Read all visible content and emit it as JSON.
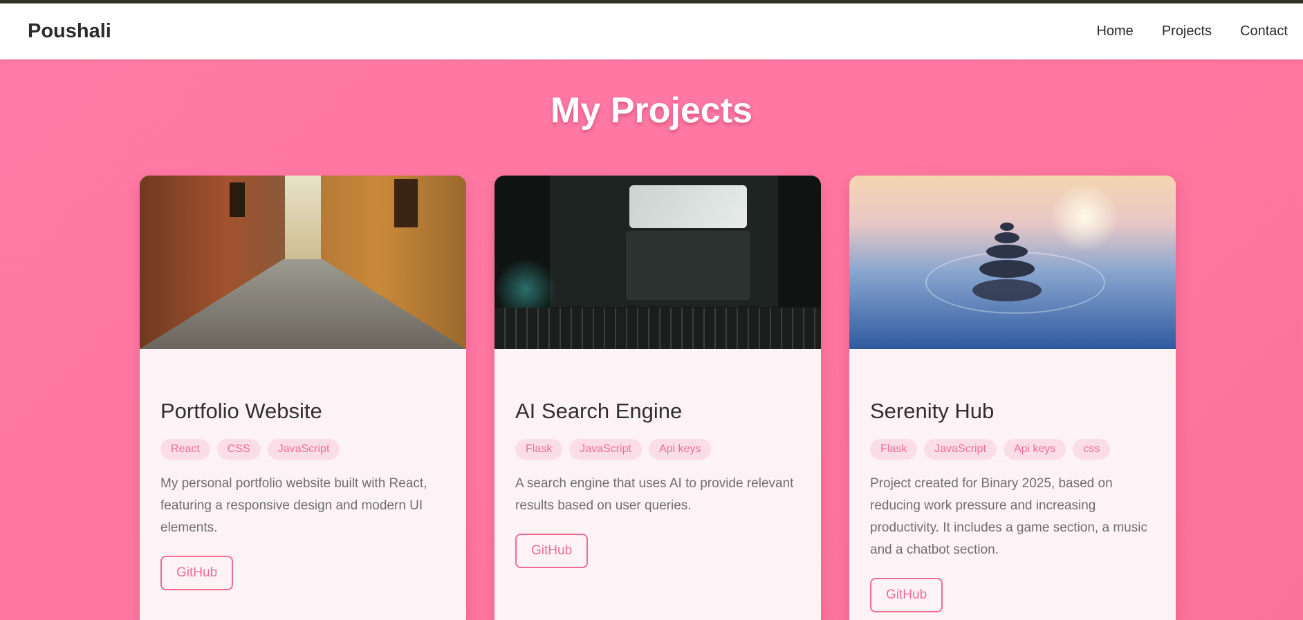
{
  "navbar": {
    "brand": "Poushali",
    "links": [
      "Home",
      "Projects",
      "Contact"
    ]
  },
  "page_title": "My Projects",
  "projects": [
    {
      "title": "Portfolio Website",
      "tags": [
        "React",
        "CSS",
        "JavaScript"
      ],
      "description": "My personal portfolio website built with React, featuring a responsive design and modern UI elements.",
      "button": "GitHub"
    },
    {
      "title": "AI Search Engine",
      "tags": [
        "Flask",
        "JavaScript",
        "Api keys"
      ],
      "description": "A search engine that uses AI to provide relevant results based on user queries.",
      "button": "GitHub"
    },
    {
      "title": "Serenity Hub",
      "tags": [
        "Flask",
        "JavaScript",
        "Api keys",
        "css"
      ],
      "description": "Project created for Binary 2025, based on reducing work pressure and increasing productivity. It includes a game section, a music and a chatbot section.",
      "button": "GitHub"
    }
  ],
  "colors": {
    "accent": "#f06b93",
    "background": "#ff78a3",
    "card": "#fdf3f6"
  }
}
